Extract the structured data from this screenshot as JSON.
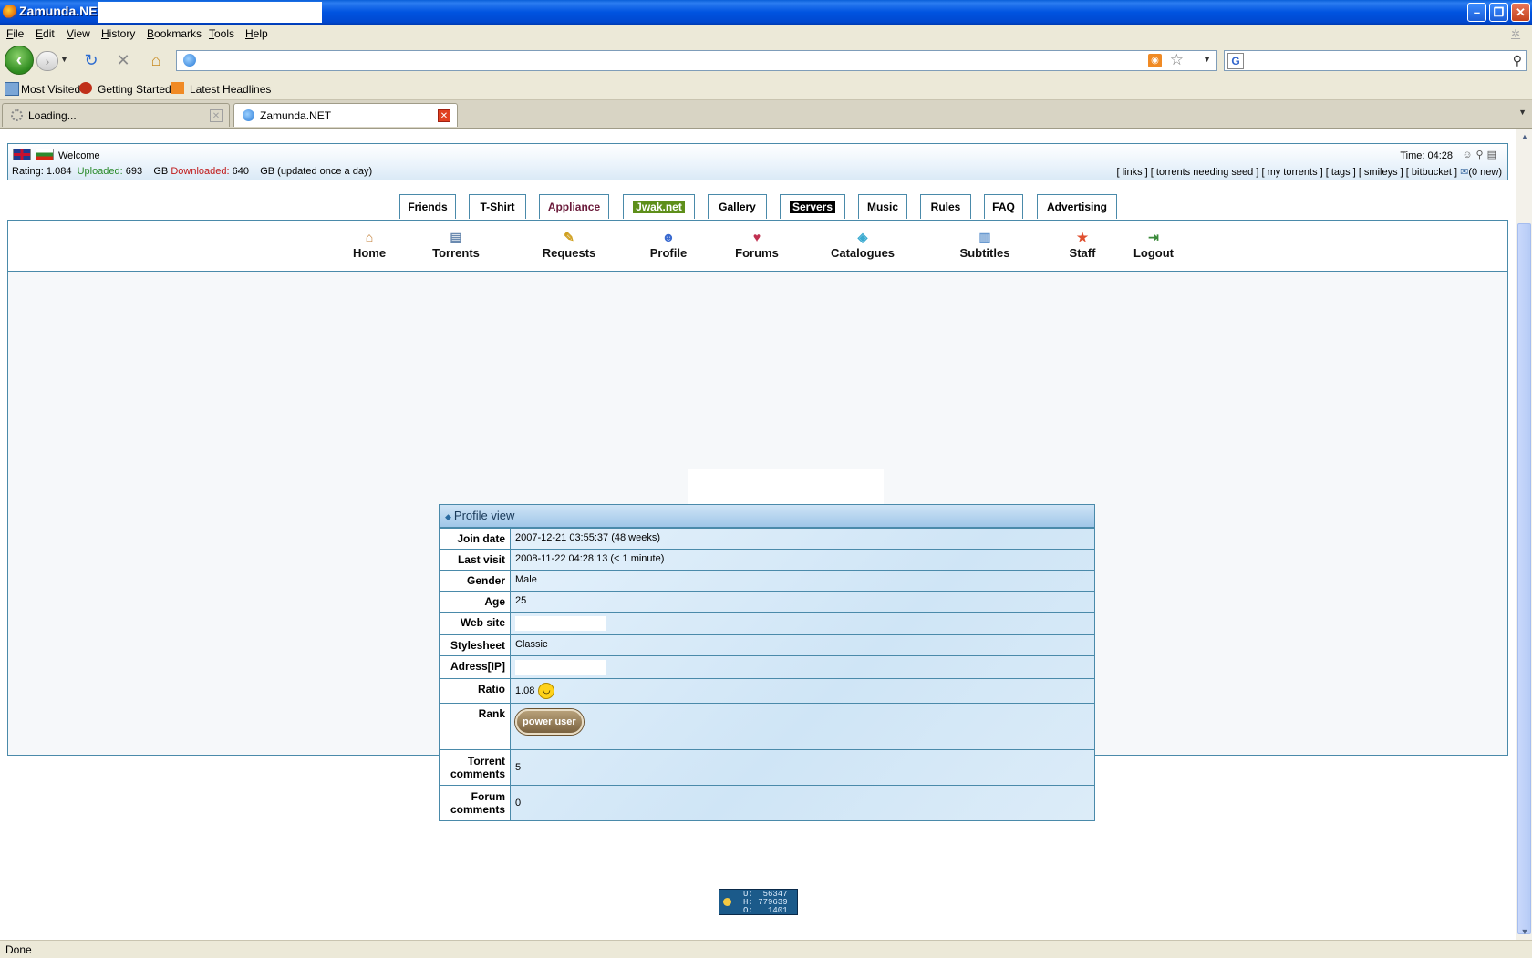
{
  "window": {
    "title": "Zamunda.NET"
  },
  "menu": [
    "File",
    "Edit",
    "View",
    "History",
    "Bookmarks",
    "Tools",
    "Help"
  ],
  "bookmarks": [
    "Most Visited",
    "Getting Started",
    "Latest Headlines"
  ],
  "tabs": [
    {
      "label": "Loading...",
      "active": false
    },
    {
      "label": "Zamunda.NET",
      "active": true
    }
  ],
  "userbar": {
    "welcome": "Welcome",
    "rating_text": "Rating: 1.084",
    "uploaded_label": "Uploaded:",
    "uploaded_value": "693",
    "gb1": "GB",
    "downloaded_label": "Downloaded:",
    "downloaded_value": "640",
    "gb2": "GB (updated once a day)",
    "time": "Time: 04:28",
    "links": "[ links ] [ torrents needing seed ] [ my torrents ] [ tags ] [ smileys ] [ bitbucket ]",
    "messages": "(0 new)"
  },
  "top_tabs": [
    "Friends",
    "T-Shirt",
    "Appliance",
    "Jwak.net",
    "Gallery",
    "Servers",
    "Music",
    "Rules",
    "FAQ",
    "Advertising"
  ],
  "main_nav": [
    "Home",
    "Torrents",
    "Requests",
    "Profile",
    "Forums",
    "Catalogues",
    "Subtitles",
    "Staff",
    "Logout"
  ],
  "profile": {
    "title": "Profile view",
    "rows": [
      {
        "label": "Join date",
        "value": "2007-12-21 03:55:37 (48 weeks)"
      },
      {
        "label": "Last visit",
        "value": "2008-11-22 04:28:13 (< 1 minute)"
      },
      {
        "label": "Gender",
        "value": "Male"
      },
      {
        "label": "Age",
        "value": "25"
      },
      {
        "label": "Web site",
        "value": ""
      },
      {
        "label": "Stylesheet",
        "value": "Classic"
      },
      {
        "label": "Adress[IP]",
        "value": ""
      },
      {
        "label": "Ratio",
        "value": "1.08"
      },
      {
        "label": "Rank",
        "value": "power user"
      },
      {
        "label": "Torrent comments",
        "value": "5"
      },
      {
        "label": "Forum comments",
        "value": "0"
      }
    ]
  },
  "counter": {
    "u": "U:  56347",
    "h": "H: 779639",
    "o": "O:   1401"
  },
  "status": "Done",
  "colors": {
    "titlebar": "#0053e0",
    "border": "#4a8aaa",
    "uploaded": "#2a8a2a",
    "downloaded": "#c01818"
  },
  "icons": [
    "back-icon",
    "forward-icon",
    "reload-icon",
    "stop-icon",
    "home-icon",
    "rss-icon",
    "star-icon",
    "search-icon",
    "smiley-icon"
  ]
}
